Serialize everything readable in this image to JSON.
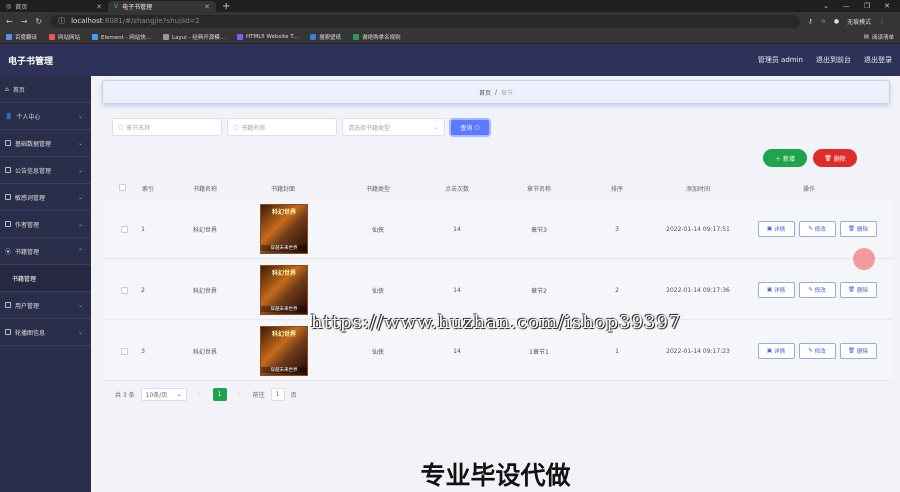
{
  "browser": {
    "tabs": [
      {
        "label": "首页",
        "icon": "globe-icon"
      },
      {
        "label": "电子书管理",
        "icon": "vue-icon"
      }
    ],
    "new_tab": "+",
    "url_host": "localhost",
    "url_rest": ":8081/#/zhangjie?shujiId=2",
    "profile_label": "无痕模式",
    "bookmarks": [
      "百度翻译",
      "网站网站",
      "Element - 网站快...",
      "Layui - 经典开源模...",
      "HTML5 Website T...",
      "搜索壁纸",
      "谢绝购拿名规则"
    ],
    "reading_list": "阅读清单"
  },
  "header": {
    "title": "电子书管理",
    "admin": "管理员 admin",
    "back_to_frontend": "退出到前台",
    "logout": "退出登录"
  },
  "sidebar": {
    "items": [
      {
        "label": "首页",
        "icon": "home-icon"
      },
      {
        "label": "个人中心",
        "icon": "user-icon"
      },
      {
        "label": "基础数据管理",
        "icon": "grid-icon"
      },
      {
        "label": "公告信息管理",
        "icon": "grid-icon"
      },
      {
        "label": "敏感词管理",
        "icon": "grid-icon"
      },
      {
        "label": "作者管理",
        "icon": "grid-icon"
      },
      {
        "label": "书籍管理",
        "icon": "location-icon"
      },
      {
        "label": "书籍管理",
        "icon": ""
      },
      {
        "label": "用户管理",
        "icon": "grid-icon"
      },
      {
        "label": "轮播图信息",
        "icon": "grid-icon"
      }
    ]
  },
  "breadcrumb": {
    "home": "首页",
    "sep": "/",
    "current": "章节"
  },
  "search": {
    "chapter_placeholder": "章节名称",
    "book_placeholder": "书籍名称",
    "type_placeholder": "请选择书籍类型",
    "search_label": "查询"
  },
  "actions": {
    "add": "新增",
    "delete": "删除"
  },
  "table": {
    "headers": [
      "索引",
      "书籍名称",
      "书籍封面",
      "书籍类型",
      "点击次数",
      "章节名称",
      "排序",
      "添加时间",
      "操作"
    ],
    "cover_title": "科幻世界",
    "cover_sub": "穿越未来世界",
    "rows": [
      {
        "index": "1",
        "name": "科幻世界",
        "type": "仙侠",
        "clicks": "14",
        "chapter": "章节3",
        "sort": "3",
        "time": "2022-01-14 09:17:51"
      },
      {
        "index": "2",
        "name": "科幻世界",
        "type": "仙侠",
        "clicks": "14",
        "chapter": "章节2",
        "sort": "2",
        "time": "2022-01-14 09:17:36"
      },
      {
        "index": "3",
        "name": "科幻世界",
        "type": "仙侠",
        "clicks": "14",
        "chapter": "1章节1",
        "sort": "1",
        "time": "2022-01-14 09:17:23"
      }
    ],
    "op_detail": "详情",
    "op_edit": "修改",
    "op_delete": "删除"
  },
  "pager": {
    "total": "共 3 条",
    "size": "10条/页",
    "page": "1",
    "goto": "前往",
    "page_unit": "页"
  },
  "watermark": "https://www.huzhan.com/ishop39397",
  "footer_text": "专业毕设代做",
  "colors": {
    "sidebar": "#2b2e4a",
    "header": "#2f3258",
    "accent": "#5b7bff",
    "success": "#1fa34b",
    "danger": "#e02b2b"
  }
}
